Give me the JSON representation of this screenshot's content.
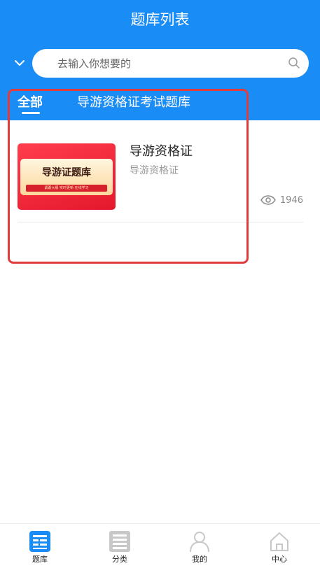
{
  "header": {
    "title": "题库列表"
  },
  "search": {
    "placeholder": "去输入你想要的"
  },
  "tabs": [
    {
      "label": "全部",
      "active": true
    },
    {
      "label": "导游资格证考试题库",
      "active": false
    }
  ],
  "items": [
    {
      "thumb_title": "导游证题库",
      "thumb_subtitle": "紧跟大纲·实时更新·在线学习",
      "title": "导游资格证",
      "subtitle": "导游资格证",
      "views": "1946"
    }
  ],
  "bottom_nav": [
    {
      "label": "题库",
      "icon": "question-bank-icon",
      "active": true
    },
    {
      "label": "分类",
      "icon": "category-icon",
      "active": false
    },
    {
      "label": "我的",
      "icon": "user-icon",
      "active": false
    },
    {
      "label": "中心",
      "icon": "home-icon",
      "active": false
    }
  ],
  "colors": {
    "primary": "#1a8cf5",
    "highlight": "#e03c3c",
    "inactive_icon": "#c8c8c8"
  }
}
